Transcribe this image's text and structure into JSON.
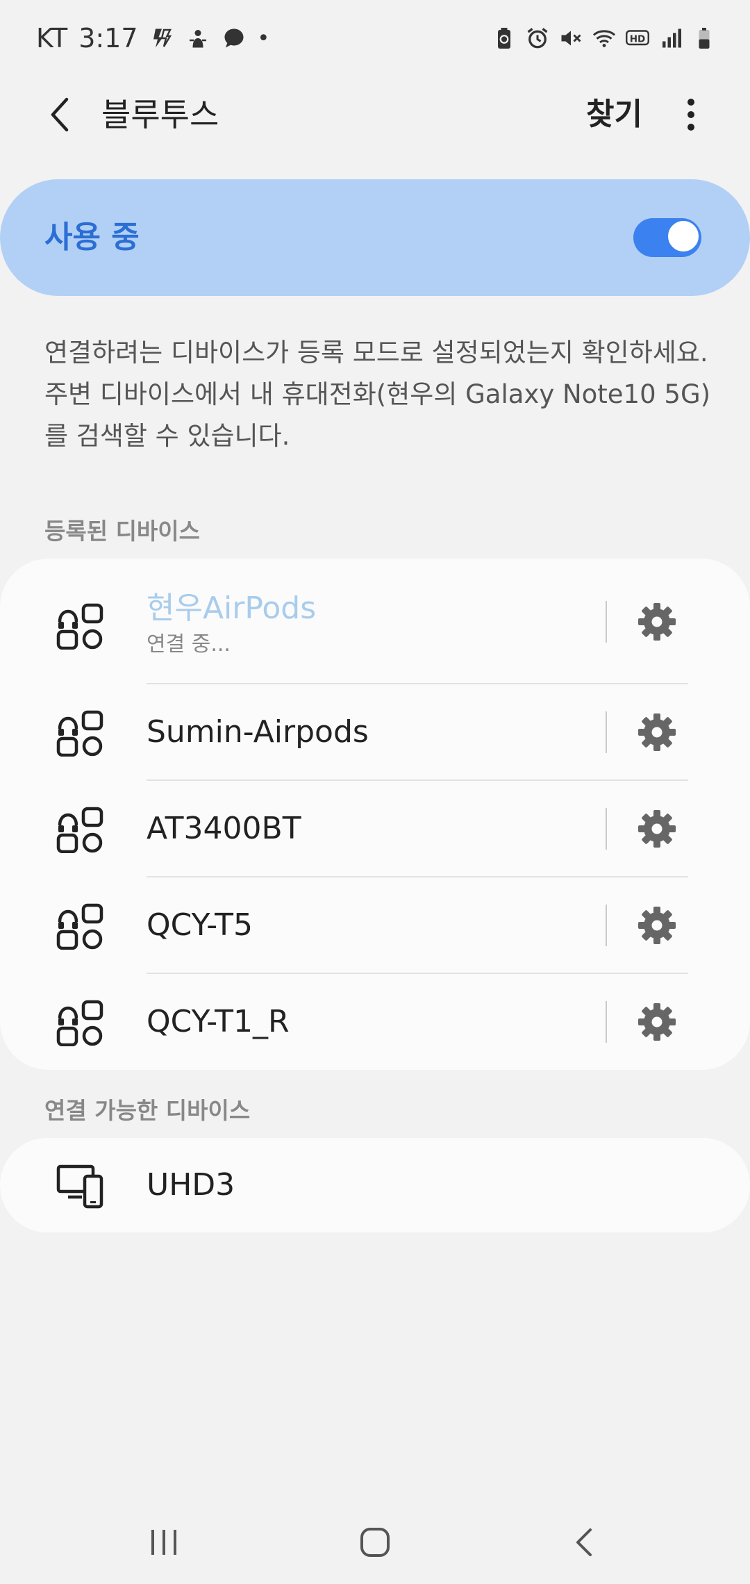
{
  "status_bar": {
    "carrier": "KT",
    "time": "3:17",
    "dot": "•",
    "left_icons": [
      "flash-icon",
      "touch-icon",
      "chat-bubble-icon"
    ],
    "right_icons": [
      "battery-saver-icon",
      "alarm-icon",
      "mute-icon",
      "wifi-icon",
      "hd-icon",
      "signal-icon",
      "battery-icon"
    ]
  },
  "header": {
    "back_icon": "chevron-left-icon",
    "title": "블루투스",
    "search_label": "찾기",
    "more_icon": "more-vertical-icon"
  },
  "master_switch": {
    "label": "사용 중",
    "enabled": true,
    "accent_color": "#3b82f0",
    "background_color": "#b2d0f5"
  },
  "description": "연결하려는 디바이스가 등록 모드로 설정되었는지 확인하세요. 주변 디바이스에서 내 휴대전화(현우의 Galaxy Note10 5G)를 검색할 수 있습니다.",
  "registered": {
    "header": "등록된 디바이스",
    "devices": [
      {
        "name": "현우AirPods",
        "status": "연결 중...",
        "icon": "earbuds-icon",
        "connecting": true
      },
      {
        "name": "Sumin-Airpods",
        "icon": "earbuds-icon"
      },
      {
        "name": "AT3400BT",
        "icon": "earbuds-icon"
      },
      {
        "name": "QCY-T5",
        "icon": "earbuds-icon"
      },
      {
        "name": "QCY-T1_R",
        "icon": "earbuds-icon"
      }
    ]
  },
  "available": {
    "header": "연결 가능한 디바이스",
    "devices": [
      {
        "name": "UHD3",
        "icon": "display-device-icon"
      }
    ]
  },
  "nav_bar": {
    "icons": [
      "recents-icon",
      "home-icon",
      "back-icon"
    ]
  }
}
